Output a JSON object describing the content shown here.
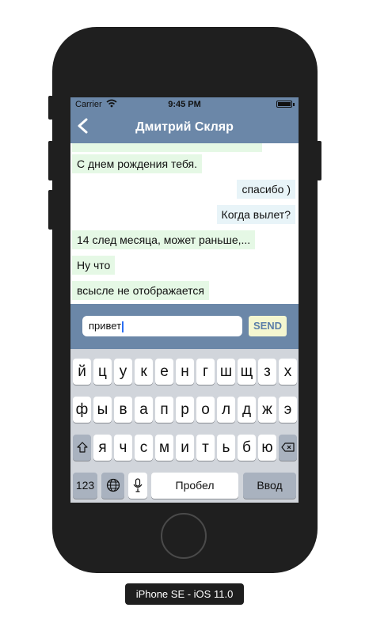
{
  "status_bar": {
    "carrier": "Carrier",
    "wifi_icon": "wifi-icon",
    "time": "9:45 PM",
    "battery_icon": "battery-icon"
  },
  "nav": {
    "back_icon": "chevron-left-icon",
    "title": "Дмитрий Скляр"
  },
  "messages": [
    {
      "text": "С днем рождения тебя.",
      "direction": "incoming"
    },
    {
      "text": "спасибо )",
      "direction": "outgoing"
    },
    {
      "text": "Когда вылет?",
      "direction": "outgoing"
    },
    {
      "text": "14 след месяца, может раньше,...",
      "direction": "incoming"
    },
    {
      "text": "Ну что",
      "direction": "incoming"
    },
    {
      "text": "всысле не отображается",
      "direction": "incoming"
    }
  ],
  "input": {
    "value": "привет",
    "send_label": "SEND"
  },
  "keyboard": {
    "row1": [
      "й",
      "ц",
      "у",
      "к",
      "е",
      "н",
      "г",
      "ш",
      "щ",
      "з",
      "х"
    ],
    "row2": [
      "ф",
      "ы",
      "в",
      "а",
      "п",
      "р",
      "о",
      "л",
      "д",
      "ж",
      "э"
    ],
    "row3": [
      "я",
      "ч",
      "с",
      "м",
      "и",
      "т",
      "ь",
      "б",
      "ю"
    ],
    "numbers_label": "123",
    "globe_icon": "globe-icon",
    "mic_icon": "mic-icon",
    "space_label": "Пробел",
    "return_label": "Ввод",
    "shift_icon": "shift-icon",
    "backspace_icon": "backspace-icon"
  },
  "device_label": "iPhone SE - iOS 11.0",
  "colors": {
    "bar": "#6b87a8",
    "incoming_bubble": "#e5f8e5",
    "outgoing_bubble": "#e8f4f8",
    "send_button": "#f4f6d0"
  }
}
